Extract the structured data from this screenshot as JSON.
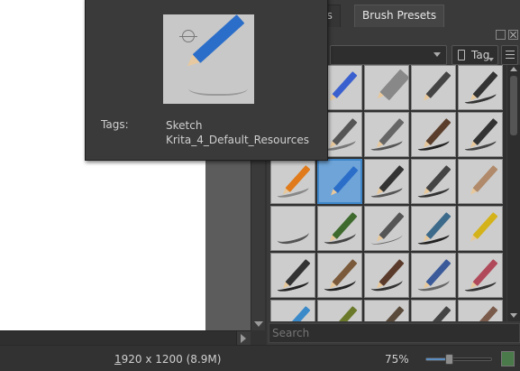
{
  "docker": {
    "tab_other_partial": "ns",
    "tab_active": "Brush Presets",
    "title_partial": "s",
    "tag_label": "Tag",
    "search_placeholder": "Search"
  },
  "tooltip": {
    "tags_label": "Tags:",
    "tags": [
      "Sketch",
      "Krita_4_Default_Resources"
    ]
  },
  "statusbar": {
    "image_size_hotkey_letter": "1",
    "image_size_rest": "920 x 1200 (8.9M)",
    "zoom_level": "75%",
    "zoom_slider_position_percent": 35
  },
  "icons": {
    "float": "float-icon",
    "close": "close-icon",
    "tag": "tag-icon",
    "view_mode": "list-view-icon",
    "zoom_fit": "zoom-fit-icon"
  },
  "colors": {
    "accent": "#3f86c9",
    "selected_tile": "#6ea4d8",
    "panel": "#3a3a3a",
    "background": "#323232"
  }
}
